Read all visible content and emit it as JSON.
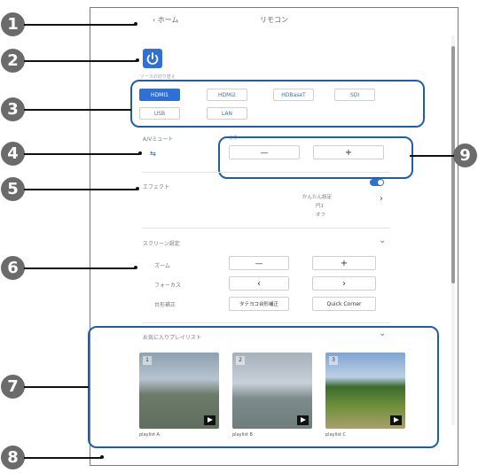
{
  "header": {
    "back_label": "ホーム",
    "title": "リモコン"
  },
  "source_label": "ソースの切り替え",
  "sources": [
    "HDMI1",
    "HDMI2",
    "HDBaseT",
    "SDI",
    "USB",
    "LAN"
  ],
  "av_mute": {
    "label": "A/Vミュート"
  },
  "volume": {
    "label": "音量",
    "minus": "—",
    "plus": "+"
  },
  "effect": {
    "label": "エフェクト",
    "values": [
      "かんたん設定",
      "円1",
      "オフ"
    ]
  },
  "screen": {
    "label": "スクリーン設定",
    "zoom": "ズーム",
    "focus": "フォーカス",
    "keystone": "台形補正",
    "keystone_btn": "タテヨコ台形補正",
    "quick_corner": "Quick Corner"
  },
  "playlist": {
    "label": "お気に入りプレイリスト",
    "items": [
      {
        "num": "1",
        "name": "playlist A"
      },
      {
        "num": "2",
        "name": "playlist B"
      },
      {
        "num": "3",
        "name": "playlist C"
      }
    ]
  },
  "callouts": [
    "1",
    "2",
    "3",
    "4",
    "5",
    "6",
    "7",
    "8",
    "9"
  ],
  "colors": {
    "accent": "#2f70d6",
    "callout_border": "#1f5fa8",
    "callout_fill": "#6b6b6b"
  }
}
